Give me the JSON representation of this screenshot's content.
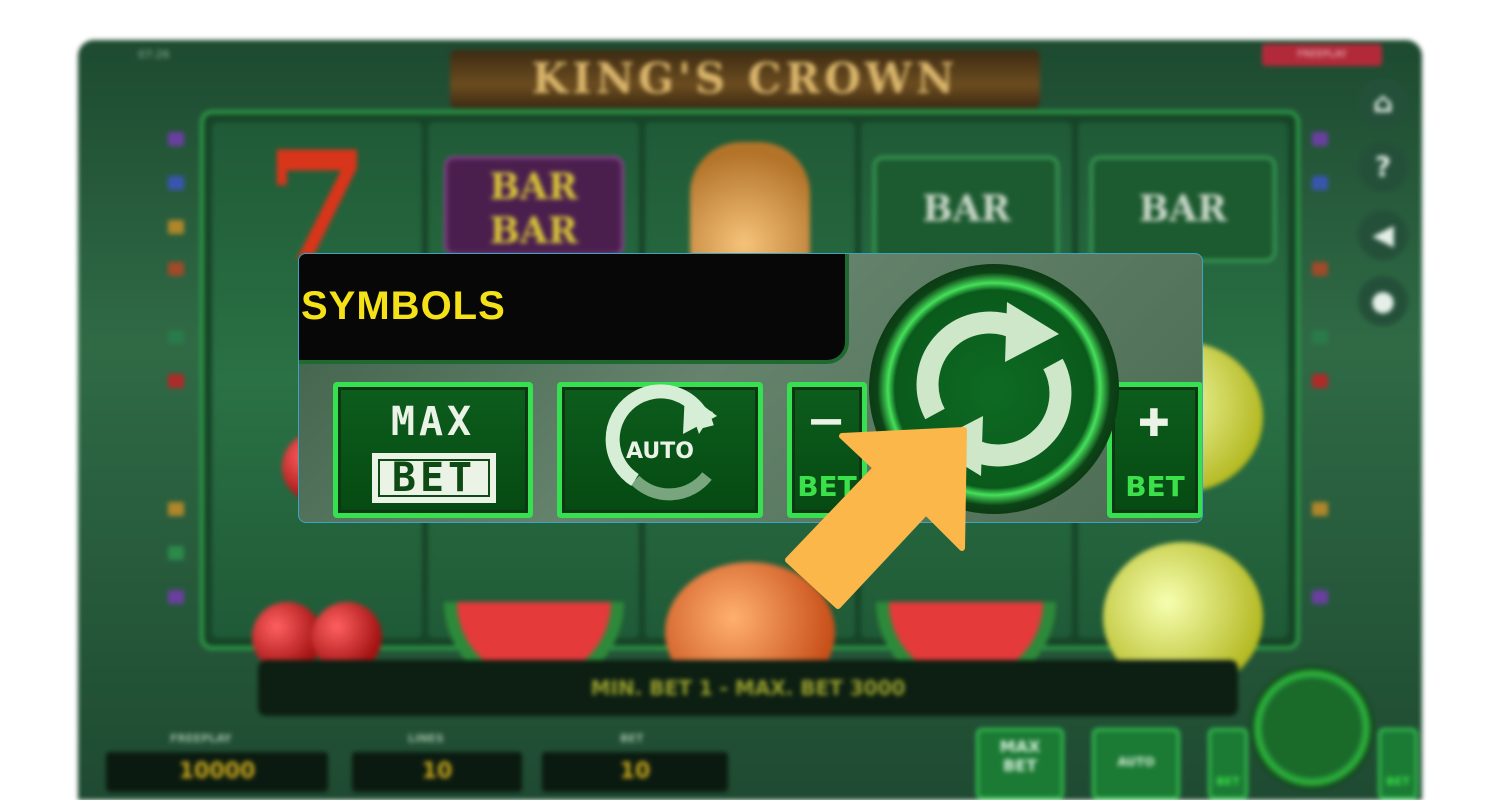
{
  "game": {
    "title": "KING'S CROWN",
    "clock": "07:26",
    "mode_tag": "FREEPLAY",
    "message": "MIN. BET 1 - MAX. BET 3000",
    "stats": [
      {
        "label": "FREEPLAY",
        "value": "10000"
      },
      {
        "label": "LINES",
        "value": "10"
      },
      {
        "label": "BET",
        "value": "10"
      }
    ],
    "reel_symbols": [
      "BAR",
      "BAR",
      "BAR",
      "BAR"
    ],
    "side_icons": [
      "home-icon",
      "help-icon",
      "sound-icon",
      "settings-icon"
    ]
  },
  "popup": {
    "heading": "SYMBOLS",
    "max_bet_top": "MAX",
    "max_bet_bottom": "BET",
    "auto_label": "AUTO",
    "minus_symbol": "−",
    "minus_label": "BET",
    "plus_symbol": "✚",
    "plus_label": "BET"
  },
  "mini_controls": {
    "max_top": "MAX",
    "max_bottom": "BET",
    "auto_label": "AUTO",
    "minus_label": "BET",
    "plus_label": "BET"
  },
  "colors": {
    "accent_green": "#37e050",
    "symbols_yellow": "#f5e118",
    "pointer_orange": "#fbb74a",
    "popup_border": "#3fa3c3"
  }
}
